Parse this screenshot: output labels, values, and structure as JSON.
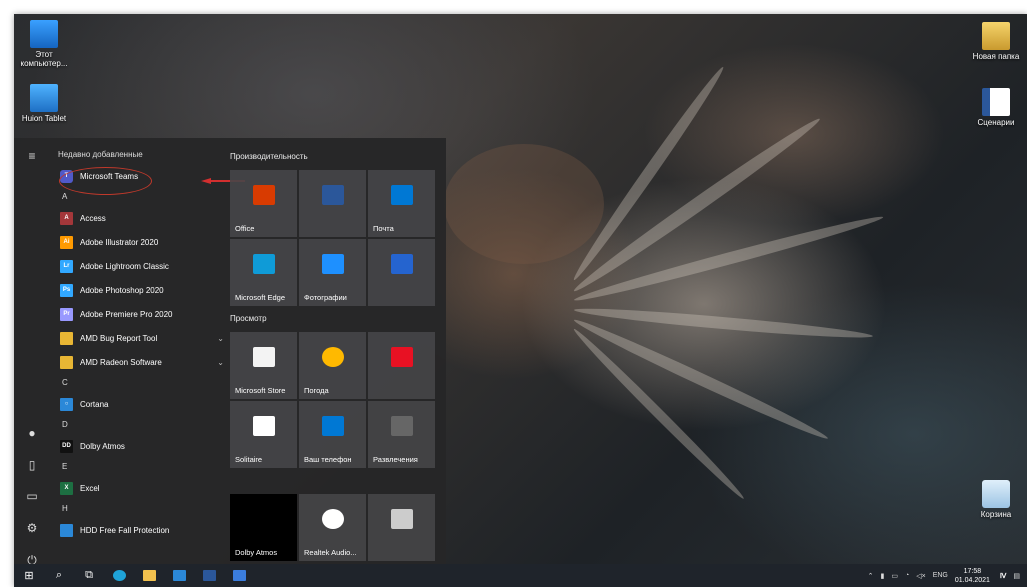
{
  "desktop": {
    "icons_left": [
      {
        "label": "Этот компьютер...",
        "icon": "computer-icon"
      },
      {
        "label": "Huion Tablet",
        "icon": "huion-tablet-icon"
      }
    ],
    "icons_right": [
      {
        "label": "Новая папка",
        "icon": "folder-icon"
      },
      {
        "label": "Сценарии",
        "icon": "word-document-icon"
      },
      {
        "label": "Корзина",
        "icon": "recycle-bin-icon"
      }
    ]
  },
  "start_menu": {
    "recent_header": "Недавно добавленные",
    "recent_app": "Microsoft Teams",
    "sections": [
      {
        "letter": "A",
        "apps": [
          {
            "label": "Access",
            "abbr": "A",
            "color": "#a4373a"
          },
          {
            "label": "Adobe Illustrator 2020",
            "abbr": "Ai",
            "color": "#ff9a00"
          },
          {
            "label": "Adobe Lightroom Classic",
            "abbr": "Lr",
            "color": "#31a8ff"
          },
          {
            "label": "Adobe Photoshop 2020",
            "abbr": "Ps",
            "color": "#31a8ff"
          },
          {
            "label": "Adobe Premiere Pro 2020",
            "abbr": "Pr",
            "color": "#9999ff"
          },
          {
            "label": "AMD Bug Report Tool",
            "abbr": "",
            "color": "#e8b634",
            "expand": "⌄"
          },
          {
            "label": "AMD Radeon Software",
            "abbr": "",
            "color": "#e8b634",
            "expand": "⌄"
          }
        ]
      },
      {
        "letter": "C",
        "apps": [
          {
            "label": "Cortana",
            "abbr": "○",
            "color": "#2b88d8"
          }
        ]
      },
      {
        "letter": "D",
        "apps": [
          {
            "label": "Dolby Atmos",
            "abbr": "DD",
            "color": "#111111"
          }
        ]
      },
      {
        "letter": "E",
        "apps": [
          {
            "label": "Excel",
            "abbr": "X",
            "color": "#1d6f42"
          }
        ]
      },
      {
        "letter": "H",
        "apps": [
          {
            "label": "HDD Free Fall Protection",
            "abbr": "",
            "color": "#2b88d8"
          }
        ]
      }
    ],
    "tile_groups": [
      {
        "title": "Производительность"
      },
      {
        "title": "Просмотр"
      }
    ],
    "tiles": [
      {
        "label": "Office",
        "icon": "office-icon",
        "color": "#d83b01"
      },
      {
        "label": "",
        "icon": "office-apps-icon",
        "color": "#2b579a"
      },
      {
        "label": "Почта",
        "icon": "mail-icon",
        "color": "#0078d4"
      },
      {
        "label": "Microsoft Edge",
        "icon": "edge-icon",
        "color": "#0f9bd7"
      },
      {
        "label": "Фотографии",
        "icon": "photos-icon",
        "color": "#1e90ff"
      },
      {
        "label": "",
        "icon": "todo-icon",
        "color": "#2564cf"
      },
      {
        "label": "Microsoft Store",
        "icon": "store-icon",
        "color": "#f3f3f3"
      },
      {
        "label": "Погода",
        "icon": "weather-icon",
        "color": "#ffb900"
      },
      {
        "label": "",
        "icon": "news-icon",
        "color": "#e81123"
      },
      {
        "label": "Solitaire",
        "icon": "solitaire-icon",
        "color": "#ffffff"
      },
      {
        "label": "Ваш телефон",
        "icon": "phone-icon",
        "color": "#0078d4"
      },
      {
        "label": "Развлечения",
        "icon": "entertainment-icon",
        "color": "#666666"
      },
      {
        "label": "Dolby Atmos",
        "icon": "dolby-icon",
        "color": "#000000"
      },
      {
        "label": "Realtek Audio...",
        "icon": "realtek-icon",
        "color": "#ffffff"
      },
      {
        "label": "",
        "icon": "security-icon",
        "color": "#cccccc"
      }
    ]
  },
  "taskbar": {
    "tray_lang": "ENG",
    "time": "17:58",
    "date": "01.04.2021"
  }
}
